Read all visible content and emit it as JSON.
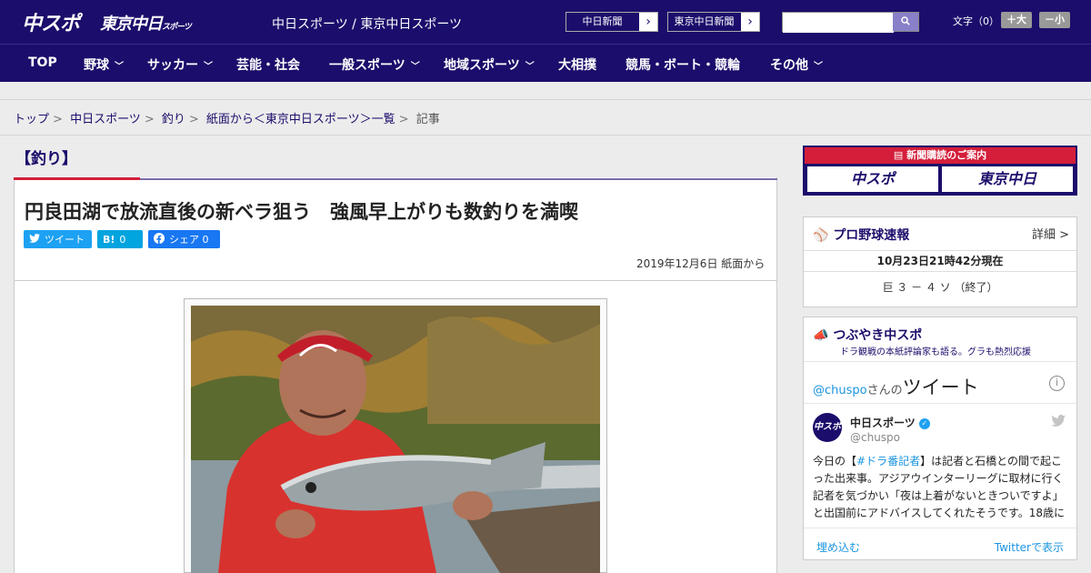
{
  "header": {
    "logo_primary": "中スポ",
    "logo_secondary": "東京中日",
    "logo_secondary_small": "スポーツ",
    "site_title": "中日スポーツ / 東京中日スポーツ",
    "np_links": [
      "中日新聞",
      "東京中日新聞"
    ],
    "search_placeholder": "",
    "font_size_label": "文字（0）",
    "font_larger": "＋大",
    "font_smaller": "－小"
  },
  "nav": {
    "items": [
      {
        "label": "TOP",
        "dropdown": false
      },
      {
        "label": "野球",
        "dropdown": true
      },
      {
        "label": "サッカー",
        "dropdown": true
      },
      {
        "label": "芸能・社会",
        "dropdown": false
      },
      {
        "label": "一般スポーツ",
        "dropdown": true
      },
      {
        "label": "地域スポーツ",
        "dropdown": true
      },
      {
        "label": "大相撲",
        "dropdown": false
      },
      {
        "label": "競馬・ボート・競輪",
        "dropdown": false
      },
      {
        "label": "その他",
        "dropdown": true
      }
    ]
  },
  "breadcrumb": {
    "items": [
      "トップ",
      "中日スポーツ",
      "釣り",
      "紙面から＜東京中日スポーツ＞一覧"
    ],
    "current": "記事"
  },
  "section": {
    "title": "【釣り】"
  },
  "article": {
    "headline": "円良田湖で放流直後の新ベラ狙う　強風早上がりも数釣りを満喫",
    "share_tweet": "ツイート",
    "share_hatena_count": "0",
    "share_facebook": "シェア 0",
    "date": "2019年12月6日 紙面から"
  },
  "sidebar": {
    "ad_title": "新聞購読のご案内",
    "ad_buttons": [
      "中スポ",
      "東京中日"
    ],
    "baseball": {
      "title": "プロ野球速報",
      "more": "詳細 >",
      "timestamp": "10月23日21時42分現在",
      "score": "巨 ３ － ４ ソ （終了）"
    },
    "tweets": {
      "title": "つぶやき中スポ",
      "subtitle": "ドラ観戦の本紙評論家も語る。グラも熱烈応援",
      "header_handle": "@chuspo",
      "header_suffix": "さんの",
      "header_label": "ツイート",
      "account_name": "中日スポーツ",
      "account_handle": "@chuspo",
      "tweet_prefix": "今日の【",
      "tweet_hashtag": "#ドラ番記者",
      "tweet_rest": "】は記者と石橋との間で起こった出来事。アジアウインターリーグに取材に行く記者を気づかい「夜は上着がないときついですよ」と出国前にアドバイスしてくれたそうです。18歳に",
      "embed_label": "埋め込む",
      "view_on_twitter": "Twitterで表示"
    }
  },
  "colors": {
    "brand_navy": "#1b0d6b",
    "accent_red": "#d41e3a",
    "twitter_blue": "#1da1f2",
    "facebook_blue": "#1877f2"
  }
}
